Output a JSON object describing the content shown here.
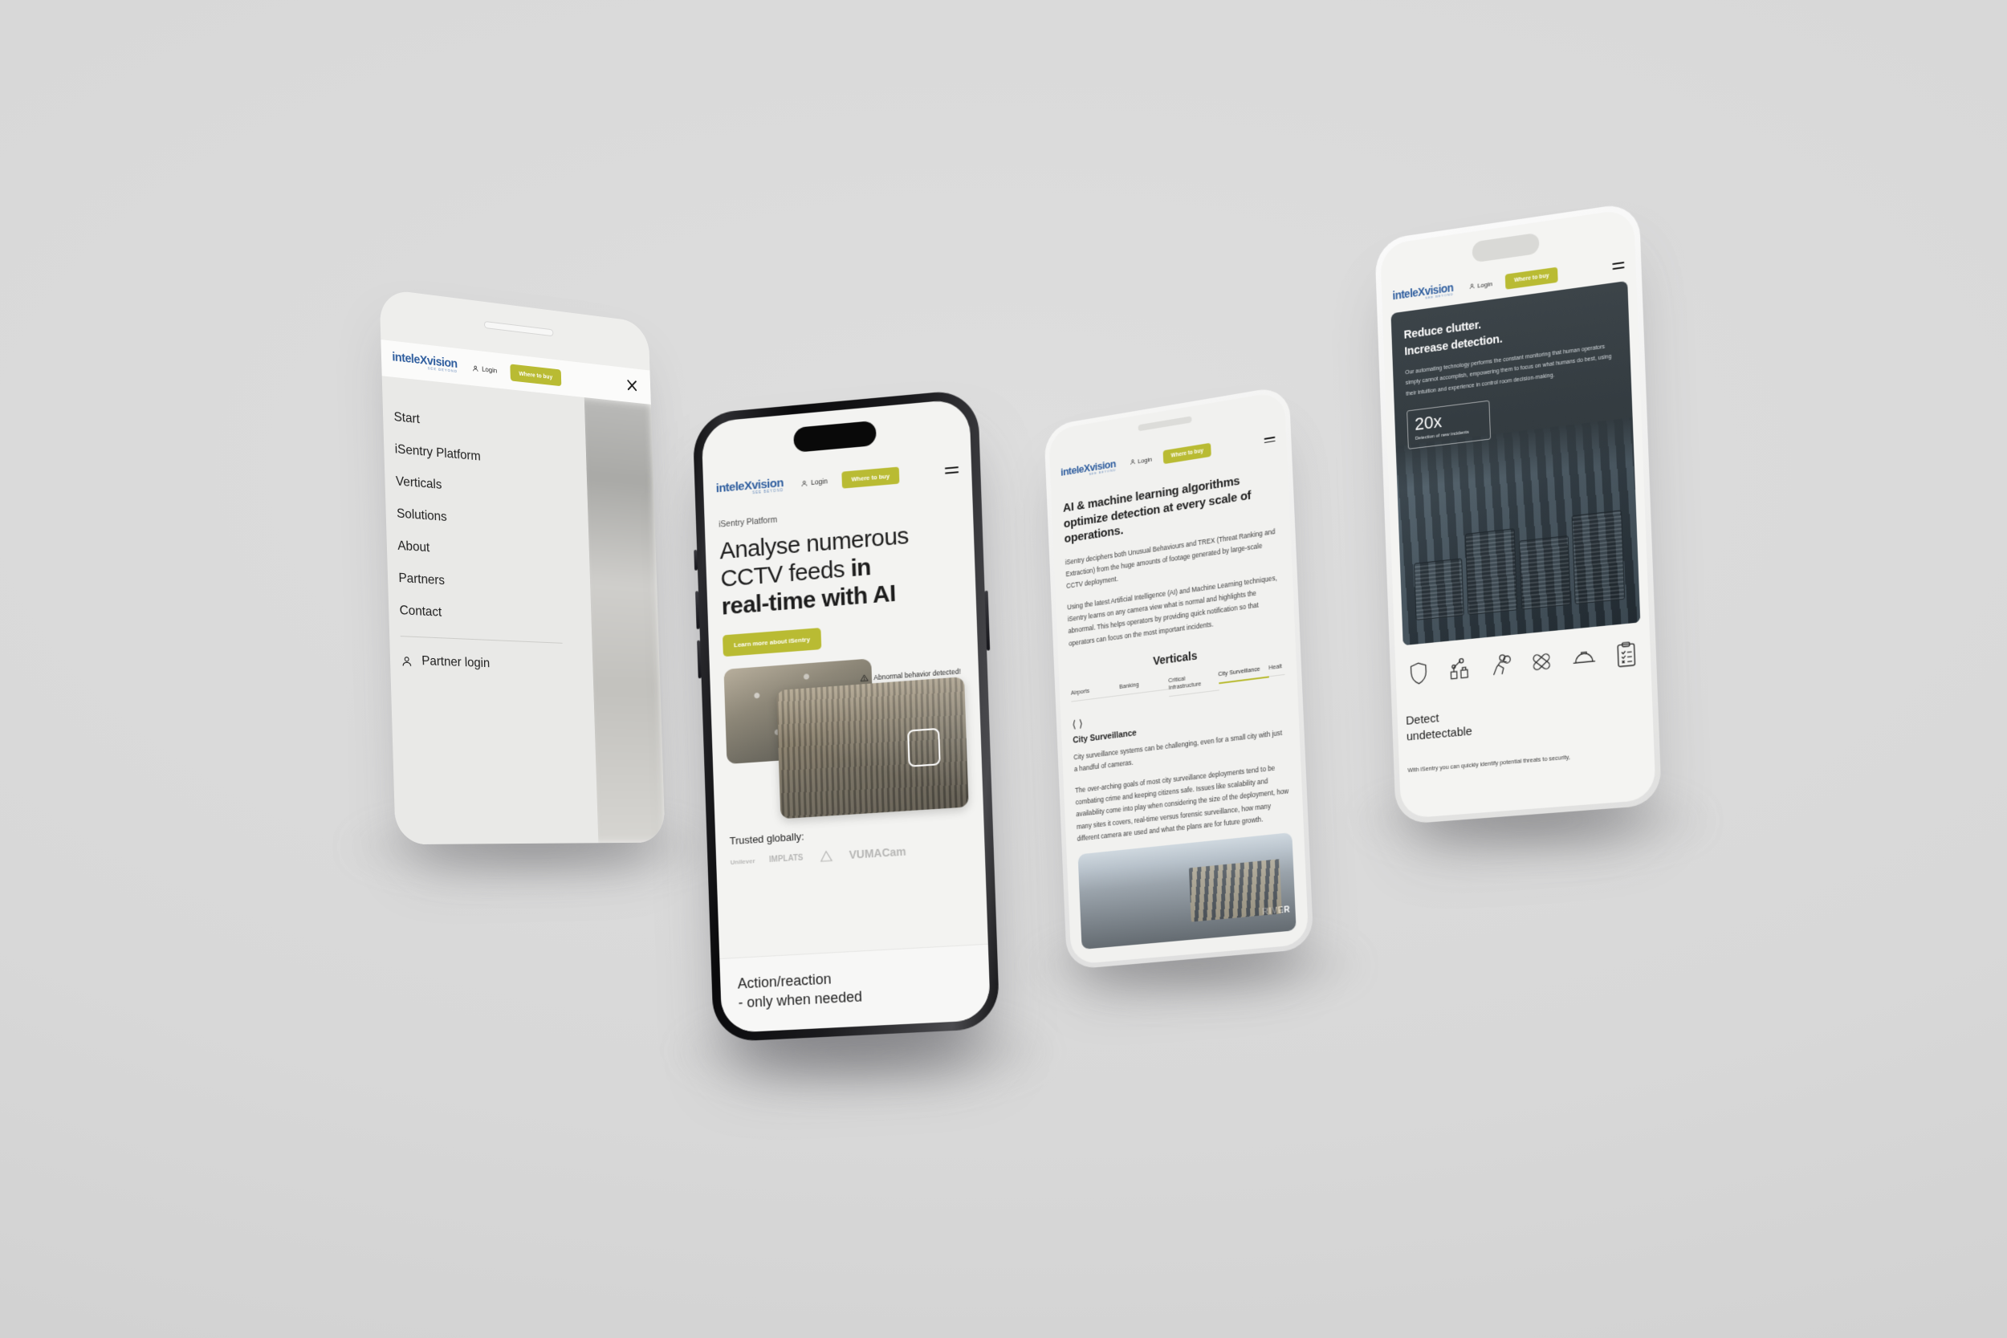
{
  "scene": {
    "background_color": "#d6d6d6",
    "brand_gold": "#b9bb33",
    "brand_blue": "#2e5d9e",
    "dark_panel": "#343c41"
  },
  "brand": {
    "logo_prefix": "i",
    "logo_main": "ntele",
    "logo_x": "X",
    "logo_suffix": "vision",
    "logo_tagline": "SEE BEYOND"
  },
  "nav": {
    "login_label": "Login",
    "where_to_buy_label": "Where to buy",
    "menu_icon": "hamburger-icon",
    "close_icon": "close-icon",
    "user_icon": "user-icon"
  },
  "phone1": {
    "menu_items": [
      {
        "label": "Start"
      },
      {
        "label": "iSentry Platform"
      },
      {
        "label": "Verticals"
      },
      {
        "label": "Solutions"
      },
      {
        "label": "About"
      },
      {
        "label": "Partners"
      },
      {
        "label": "Contact"
      }
    ],
    "partner_login_label": "Partner login",
    "partner_login_icon": "user-icon"
  },
  "phone2": {
    "eyebrow": "iSentry Platform",
    "headline_line1": "Analyse numerous",
    "headline_line2_light": "CCTV feeds ",
    "headline_line2_bold": "in",
    "headline_line3_bold": "real-time with AI",
    "cta_label": "Learn more about iSentry",
    "alert_text": "Abnormal behavior detected!",
    "alert_icon": "warning-triangle-icon",
    "detection_box_label": "detection-bounding-box",
    "trusted_label": "Trusted globally:",
    "trusted_logos": [
      {
        "name": "Unilever"
      },
      {
        "name": "IMPLATS"
      },
      {
        "name": "Anglo American"
      },
      {
        "name": "VUMACam"
      }
    ],
    "band_line1": "Action/reaction",
    "band_line2": "- only when needed"
  },
  "phone3": {
    "heading": "AI & machine learning algorithms optimize detection at every scale of operations.",
    "paragraph1": "iSentry deciphers both Unusual Behaviours and TREX (Threat Ranking and Extraction) from the huge amounts of footage generated by large-scale CCTV deployment.",
    "paragraph2": "Using the latest Artificial Intelligence (AI) and Machine Learning techniques, iSentry learns on any camera view what is normal and highlights the abnormal. This helps operators by providing quick notification so that operators can focus on the most important incidents.",
    "verticals_title": "Verticals",
    "tabs": [
      {
        "label": "Airports",
        "active": false
      },
      {
        "label": "Banking",
        "active": false
      },
      {
        "label": "Critical Infrastructure",
        "active": false
      },
      {
        "label": "City Surveillance",
        "active": true
      },
      {
        "label": "Healt",
        "active": false
      }
    ],
    "carousel_prev_icon": "chevron-left-icon",
    "carousel_next_icon": "chevron-right-icon",
    "section_title": "City Surveillance",
    "section_p1": "City surveillance systems can be challenging, even for a small city  with just a handful of cameras.",
    "section_p2": "The over-arching goals of most city surveillance deployments tend to be combating crime and keeping citizens safe. Issues like scalability and availability come into play when considering the size of the deployment, how many sites it covers, real-time versus forensic surveillance,  how many different camera are used and what the plans are for future growth.",
    "photo_caption": "RIVER"
  },
  "phone4": {
    "dark_headline_line1": "Reduce clutter.",
    "dark_headline_line2": "Increase detection.",
    "dark_paragraph": "Our automating technology performs the constant monitoring that human operators simply cannot accomplish, empowering them to focus on what humans do best, using their intuition and experience in control room decision-making.",
    "stat_value": "20x",
    "stat_caption": "Detection of new incidents",
    "icons": [
      {
        "name": "shield-icon"
      },
      {
        "name": "robot-arm-icon"
      },
      {
        "name": "worker-carrying-icon"
      },
      {
        "name": "bandage-icon"
      },
      {
        "name": "hard-hat-icon"
      },
      {
        "name": "clipboard-checklist-icon"
      }
    ],
    "heading_line1": "Detect",
    "heading_line2": "undetectable",
    "subtext": "With iSentry you can quickly identify potential threats to security,"
  }
}
